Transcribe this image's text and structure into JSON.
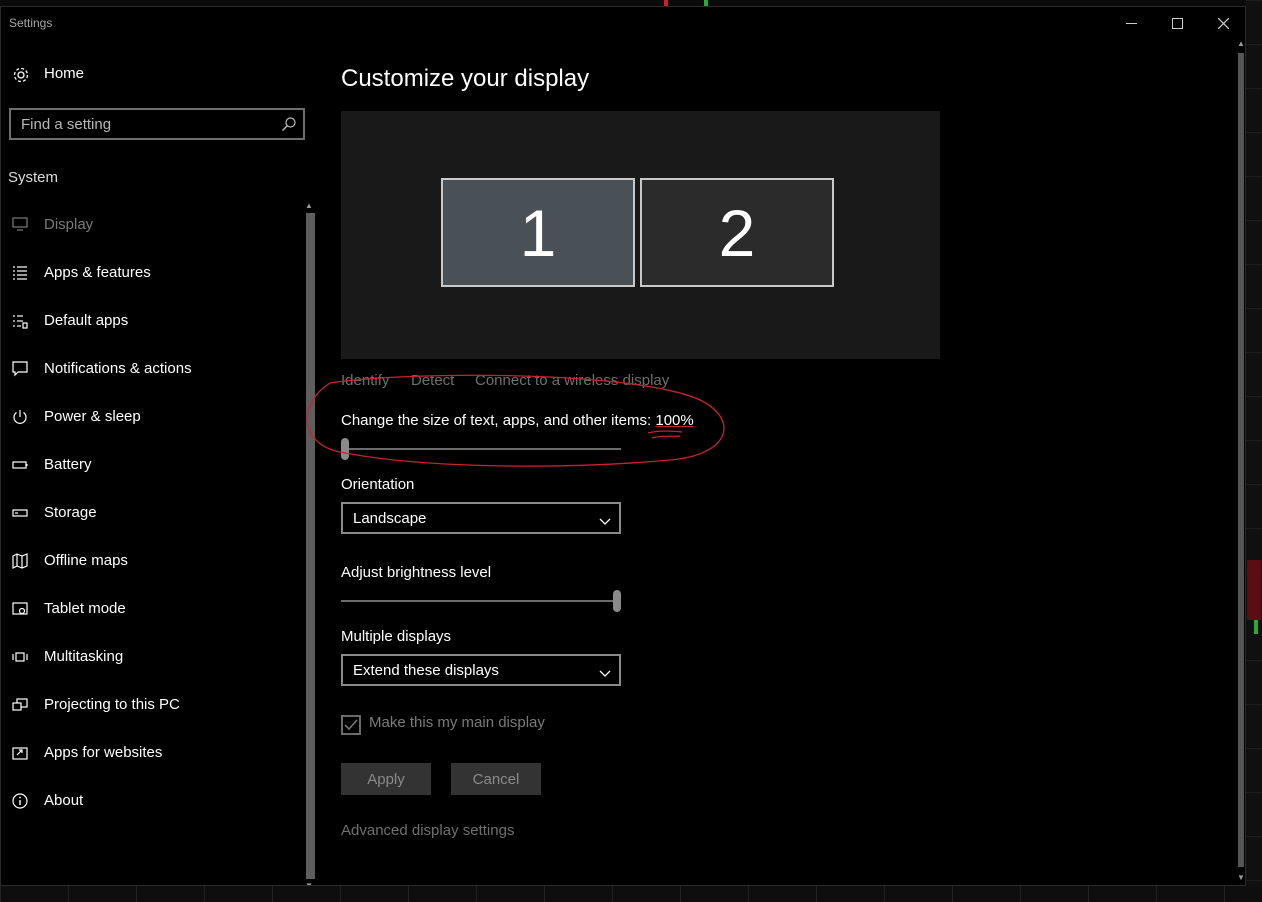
{
  "window": {
    "title": "Settings"
  },
  "sidebar": {
    "home_label": "Home",
    "search": {
      "placeholder": "Find a setting",
      "value": ""
    },
    "section": "System",
    "items": [
      {
        "label": "Display",
        "icon": "monitor-icon",
        "selected": true
      },
      {
        "label": "Apps & features",
        "icon": "list-icon"
      },
      {
        "label": "Default apps",
        "icon": "default-list-icon"
      },
      {
        "label": "Notifications & actions",
        "icon": "notification-icon"
      },
      {
        "label": "Power & sleep",
        "icon": "power-icon"
      },
      {
        "label": "Battery",
        "icon": "battery-icon"
      },
      {
        "label": "Storage",
        "icon": "storage-icon"
      },
      {
        "label": "Offline maps",
        "icon": "map-icon"
      },
      {
        "label": "Tablet mode",
        "icon": "tablet-icon"
      },
      {
        "label": "Multitasking",
        "icon": "multitask-icon"
      },
      {
        "label": "Projecting to this PC",
        "icon": "project-icon"
      },
      {
        "label": "Apps for websites",
        "icon": "web-app-icon"
      },
      {
        "label": "About",
        "icon": "info-icon"
      }
    ]
  },
  "main": {
    "title": "Customize your display",
    "monitors": [
      "1",
      "2"
    ],
    "links": {
      "identify": "Identify",
      "detect": "Detect",
      "wireless": "Connect to a wireless display"
    },
    "scale": {
      "label": "Change the size of text, apps, and other items:",
      "value": "100%",
      "slider_fraction": 0.0
    },
    "orientation": {
      "label": "Orientation",
      "value": "Landscape"
    },
    "brightness": {
      "label": "Adjust brightness level",
      "slider_fraction": 1.0
    },
    "multiple": {
      "label": "Multiple displays",
      "value": "Extend these displays"
    },
    "main_display": {
      "label": "Make this my main display",
      "checked": true
    },
    "buttons": {
      "apply": "Apply",
      "cancel": "Cancel"
    },
    "advanced_link": "Advanced display settings"
  },
  "colors": {
    "window_bg": "#000000",
    "display_area": "#191919",
    "monitor_selected": "#4a5156",
    "annotation": "#c8232c"
  }
}
